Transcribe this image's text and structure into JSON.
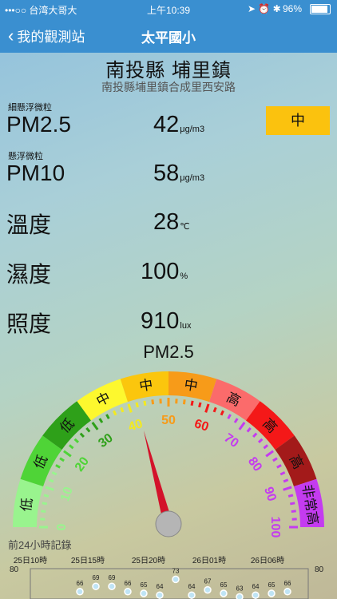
{
  "status": {
    "carrier": "•••○○ 台湾大哥大",
    "time": "上午10:39",
    "battery": "96%"
  },
  "nav": {
    "back_label": "我的觀測站",
    "title": "太平國小"
  },
  "station": {
    "name": "南投縣 埔里鎮",
    "address": "南投縣埔里鎮合成里西安路"
  },
  "readings": {
    "pm25": {
      "sublabel": "細懸浮微粒",
      "label": "PM2.5",
      "value": "42",
      "unit": "μg/m3"
    },
    "pm10": {
      "sublabel": "懸浮微粒",
      "label": "PM10",
      "value": "58",
      "unit": "μg/m3"
    },
    "temp": {
      "label": "溫度",
      "value": "28",
      "unit": "℃"
    },
    "humidity": {
      "label": "濕度",
      "value": "100",
      "unit": "%"
    },
    "illum": {
      "label": "照度",
      "value": "910",
      "unit": "lux"
    }
  },
  "level_badge": "中",
  "gauge": {
    "title": "PM2.5",
    "value": 42,
    "max": 100,
    "segments": [
      {
        "label": "低",
        "color": "#99f48e"
      },
      {
        "label": "低",
        "color": "#4fd437"
      },
      {
        "label": "低",
        "color": "#2ea019"
      },
      {
        "label": "中",
        "color": "#fdf82e"
      },
      {
        "label": "中",
        "color": "#fbc60d"
      },
      {
        "label": "中",
        "color": "#f79b19"
      },
      {
        "label": "高",
        "color": "#fb6b6b"
      },
      {
        "label": "高",
        "color": "#f41818"
      },
      {
        "label": "高",
        "color": "#a31a1a"
      },
      {
        "label": "非常高",
        "color": "#c43bf0"
      }
    ],
    "ticks": [
      {
        "label": "0",
        "color": "#99f48e"
      },
      {
        "label": "10",
        "color": "#99f48e"
      },
      {
        "label": "20",
        "color": "#4fd437"
      },
      {
        "label": "30",
        "color": "#2ea019"
      },
      {
        "label": "40",
        "color": "#f3ea1f"
      },
      {
        "label": "50",
        "color": "#f79b19"
      },
      {
        "label": "60",
        "color": "#f41818"
      },
      {
        "label": "70",
        "color": "#c43bf0"
      },
      {
        "label": "80",
        "color": "#c43bf0"
      },
      {
        "label": "90",
        "color": "#c43bf0"
      },
      {
        "label": "100",
        "color": "#c43bf0"
      }
    ]
  },
  "history": {
    "title": "前24小時記錄",
    "x_labels": [
      "25日10時",
      "25日15時",
      "25日20時",
      "26日01時",
      "26日06時"
    ],
    "y_label": "80",
    "points": [
      "66",
      "69",
      "69",
      "66",
      "65",
      "64",
      "73",
      "64",
      "67",
      "65",
      "63",
      "64",
      "65",
      "66"
    ]
  }
}
